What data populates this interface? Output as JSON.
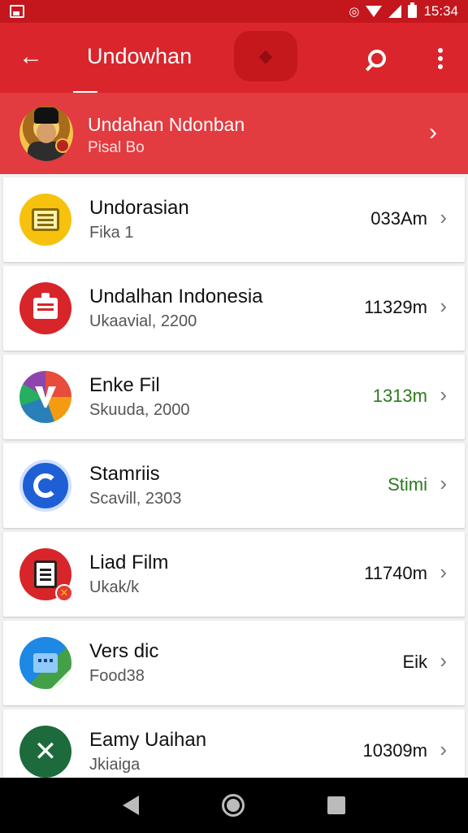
{
  "status_bar": {
    "time": "15:34",
    "icons": [
      "image-icon",
      "sync-icon",
      "wifi-icon",
      "signal-icon",
      "battery-icon"
    ]
  },
  "app_bar": {
    "title": "Undowhan",
    "back_icon": "arrow-left-icon",
    "search_icon": "search-icon",
    "more_icon": "more-vert-icon"
  },
  "header": {
    "title": "Undahan Ndonban",
    "subtitle": "Pisal Bo"
  },
  "items": [
    {
      "name": "Undorasian",
      "sub": "Fika 1",
      "meta": "033Am",
      "icon": "notes-icon",
      "color": "#f6c20e"
    },
    {
      "name": "Undalhan Indonesia",
      "sub": "Ukaavial, 2200",
      "meta": "11329m",
      "icon": "clipboard-icon",
      "color": "#d7252a"
    },
    {
      "name": "Enke Fil",
      "sub": "Skuuda, 2000",
      "meta": "1313m",
      "icon": "multicolor-v-icon",
      "color": "#2b7a1d"
    },
    {
      "name": "Stamriis",
      "sub": "Scavill, 2303",
      "meta": "Stimi",
      "icon": "refresh-ring-icon",
      "color": "#2b7a1d"
    },
    {
      "name": "Liad Film",
      "sub": "Ukak/k",
      "meta": "11740m",
      "icon": "document-error-icon",
      "color": "#d7252a"
    },
    {
      "name": "Vers dic",
      "sub": "Food38",
      "meta": "Eik",
      "icon": "chat-icon",
      "color": "#1e88e5"
    },
    {
      "name": "Eamy Uaihan",
      "sub": "Jkiaiga",
      "meta": "10309m",
      "icon": "excel-x-icon",
      "color": "#1d6b3c"
    }
  ],
  "nav": {
    "back": "nav-back-icon",
    "home": "nav-home-icon",
    "recent": "nav-recent-icon"
  }
}
